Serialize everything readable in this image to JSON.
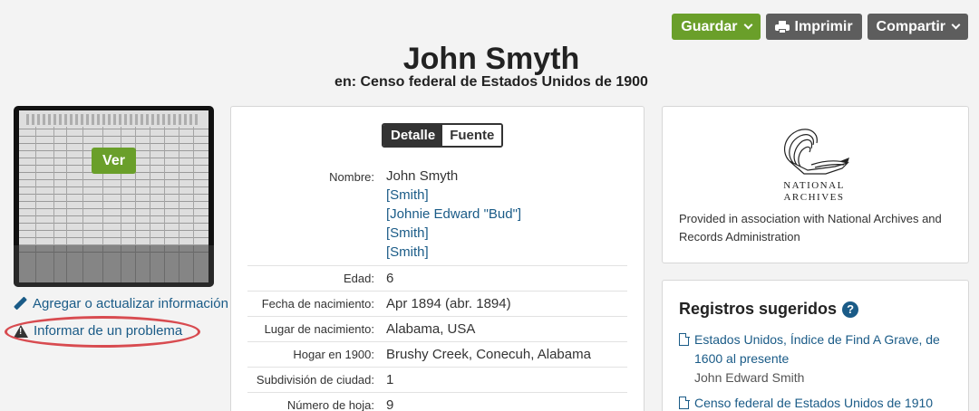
{
  "toolbar": {
    "save": "Guardar",
    "print": "Imprimir",
    "share": "Compartir"
  },
  "header": {
    "name": "John Smyth",
    "collection": "en: Censo federal de Estados Unidos de 1900"
  },
  "thumbnail": {
    "view_button": "Ver"
  },
  "side_links": {
    "add_update": "Agregar o actualizar información",
    "report_problem": "Informar de un problema"
  },
  "tabs": {
    "detail": "Detalle",
    "source": "Fuente"
  },
  "record": {
    "name_label": "Nombre:",
    "name_value": "John Smyth",
    "alt_names": [
      "[Smith]",
      "[Johnie Edward \"Bud\"]",
      "[Smith]",
      "[Smith]"
    ],
    "fields": [
      {
        "label": "Edad:",
        "value": "6"
      },
      {
        "label": "Fecha de nacimiento:",
        "value": "Apr 1894 (abr. 1894)"
      },
      {
        "label": "Lugar de nacimiento:",
        "value": "Alabama, USA"
      },
      {
        "label": "Hogar en 1900:",
        "value": "Brushy Creek, Conecuh, Alabama"
      },
      {
        "label": "Subdivisión de ciudad:",
        "value": "1"
      },
      {
        "label": "Número de hoja:",
        "value": "9"
      }
    ]
  },
  "archives": {
    "logo_line1": "NATIONAL",
    "logo_line2": "ARCHIVES",
    "text": "Provided in association with National Archives and Records Administration"
  },
  "suggested": {
    "title": "Registros sugeridos",
    "help": "?",
    "items": [
      {
        "title": "Estados Unidos, Índice de Find A Grave, de 1600 al presente",
        "sub": "John Edward Smith"
      },
      {
        "title": "Censo federal de Estados Unidos de 1910",
        "sub": ""
      }
    ]
  },
  "colors": {
    "green": "#6a9f2a",
    "gray_button": "#5d5d5d",
    "link": "#1a5b87",
    "highlight": "#d84b50"
  }
}
